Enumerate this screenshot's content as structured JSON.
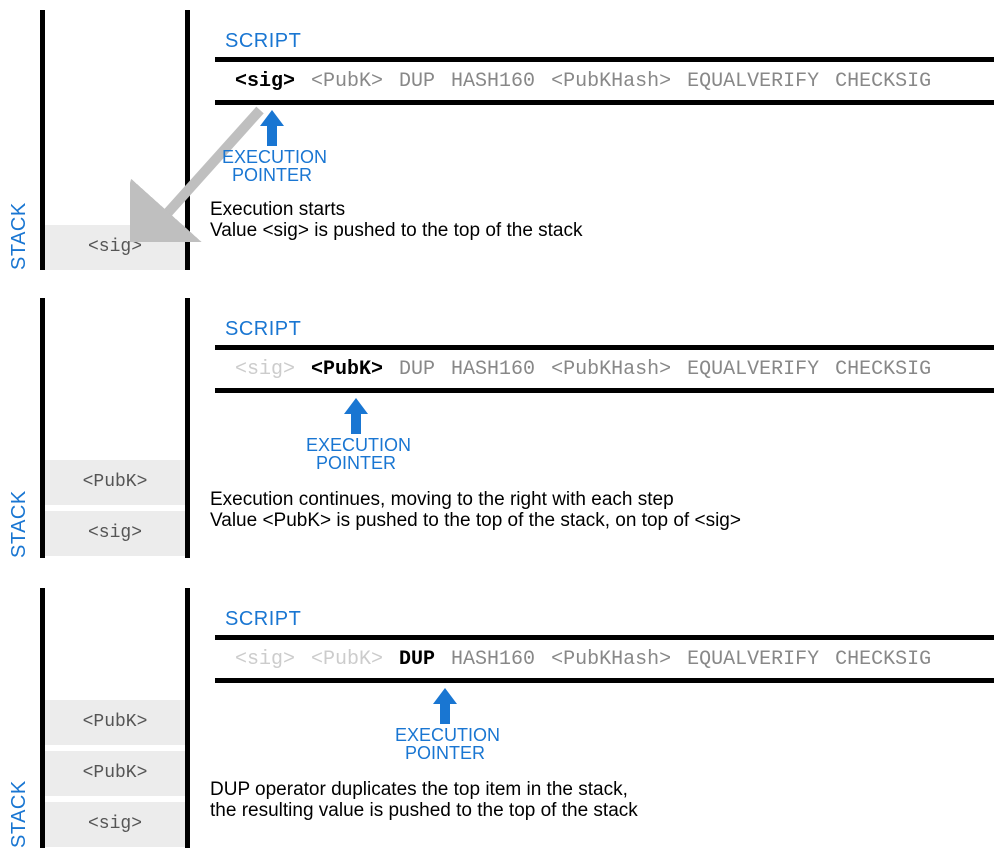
{
  "labels": {
    "stack": "STACK",
    "script": "SCRIPT",
    "pointer": "EXECUTION\nPOINTER"
  },
  "script_tokens": [
    "<sig>",
    "<PubK>",
    "DUP",
    "HASH160",
    "<PubKHash>",
    "EQUALVERIFY",
    "CHECKSIG"
  ],
  "steps": [
    {
      "active_index": 0,
      "stack": [
        "<sig>"
      ],
      "desc_lines": [
        "Execution starts",
        "Value <sig> is pushed to the top of the stack"
      ]
    },
    {
      "active_index": 1,
      "stack": [
        "<PubK>",
        "<sig>"
      ],
      "desc_lines": [
        "Execution continues, moving to the right with each step",
        "Value <PubK> is pushed to the top of the stack, on top of <sig>"
      ]
    },
    {
      "active_index": 2,
      "stack": [
        "<PubK>",
        "<PubK>",
        "<sig>"
      ],
      "desc_lines": [
        "DUP operator duplicates the top item in the stack,",
        "the resulting value is pushed to the top of the stack"
      ]
    }
  ]
}
